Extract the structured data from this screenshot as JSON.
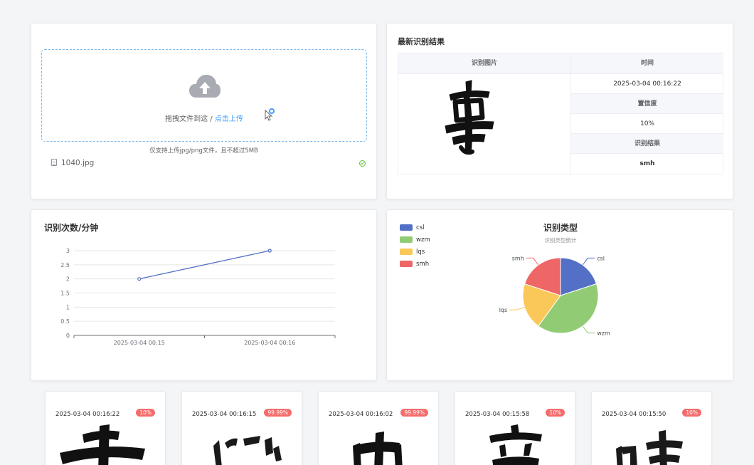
{
  "upload": {
    "drop_text": "拖拽文件到这 / ",
    "drop_link": "点击上传",
    "hint": "仅支持上传jpg/png文件，且不超过5MB",
    "file_name": "1040.jpg"
  },
  "result": {
    "title": "最新识别结果",
    "col_image": "识别图片",
    "col_time": "时间",
    "time": "2025-03-04 00:16:22",
    "confidence_label": "置信度",
    "confidence": "10%",
    "result_label": "识别结果",
    "result": "smh"
  },
  "line_chart": {
    "title": "识别次数/分钟"
  },
  "pie_chart": {
    "title": "识别类型",
    "subtitle": "识别类型统计"
  },
  "history": [
    {
      "time": "2025-03-04 00:16:22",
      "badge": "10%"
    },
    {
      "time": "2025-03-04 00:16:15",
      "badge": "99.99%"
    },
    {
      "time": "2025-03-04 00:16:02",
      "badge": "99.99%"
    },
    {
      "time": "2025-03-04 00:15:58",
      "badge": "10%"
    },
    {
      "time": "2025-03-04 00:15:50",
      "badge": "10%"
    }
  ],
  "chart_data": [
    {
      "type": "line",
      "title": "识别次数/分钟",
      "x": [
        "2025-03-04 00:15",
        "2025-03-04 00:16"
      ],
      "y_ticks": [
        "0",
        "0.5",
        "1",
        "1.5",
        "2",
        "2.5",
        "3"
      ],
      "series": [
        {
          "values": [
            2,
            3
          ],
          "color": "#5470c6"
        }
      ],
      "ylim": [
        0,
        3
      ],
      "grid": true
    },
    {
      "type": "pie",
      "title": "识别类型",
      "subtitle": "识别类型统计",
      "legend_position": "top-left",
      "slices": [
        {
          "name": "csl",
          "value": 1,
          "color": "#5470c6"
        },
        {
          "name": "wzm",
          "value": 2,
          "color": "#91cc75"
        },
        {
          "name": "lqs",
          "value": 1,
          "color": "#fac858"
        },
        {
          "name": "smh",
          "value": 1,
          "color": "#ee6666"
        }
      ]
    }
  ],
  "colors": {
    "accent": "#409eff",
    "badge": "#f56c6c",
    "success": "#67c23a"
  }
}
